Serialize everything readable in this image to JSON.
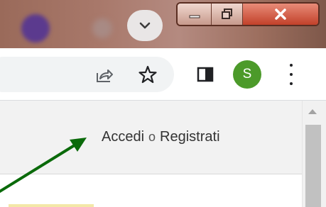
{
  "titlebar": {
    "tab_menu_icon": "chevron-down-icon",
    "window_controls": {
      "minimize_icon": "minimize-icon",
      "maximize_icon": "restore-icon",
      "close_icon": "close-icon"
    }
  },
  "toolbar": {
    "share_icon": "share-icon",
    "bookmark_icon": "star-icon",
    "side_panel_icon": "side-panel-icon",
    "profile_initial": "S",
    "menu_icon": "more-vert-icon"
  },
  "page": {
    "login_link": "Accedi",
    "separator": "o",
    "register_link": "Registrati"
  },
  "annotation": {
    "color": "#0a6a0a"
  },
  "colors": {
    "avatar": "#4c9a2a",
    "close_button": "#c2412a"
  }
}
